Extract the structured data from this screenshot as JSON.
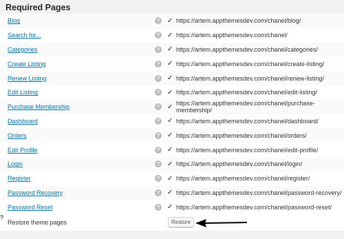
{
  "section": {
    "title": "Required Pages"
  },
  "pages": [
    {
      "label": "Blog",
      "url": "https://artem.appthemesdev.com/chanel/blog/"
    },
    {
      "label": "Search for...",
      "url": "https://artem.appthemesdev.com/chanel/"
    },
    {
      "label": "Categories",
      "url": "https://artem.appthemesdev.com/chanel/categories/"
    },
    {
      "label": "Create Listing",
      "url": "https://artem.appthemesdev.com/chanel/create-listing/"
    },
    {
      "label": "Renew Listing",
      "url": "https://artem.appthemesdev.com/chanel/renew-listing/"
    },
    {
      "label": "Edit Listing",
      "url": "https://artem.appthemesdev.com/chanel/edit-listing/"
    },
    {
      "label": "Purchase Membership",
      "url": "https://artem.appthemesdev.com/chanel/purchase-membership/"
    },
    {
      "label": "Dashboard",
      "url": "https://artem.appthemesdev.com/chanel/dashboard/"
    },
    {
      "label": "Orders",
      "url": "https://artem.appthemesdev.com/chanel/orders/"
    },
    {
      "label": "Edit Profile",
      "url": "https://artem.appthemesdev.com/chanel/edit-profile/"
    },
    {
      "label": "Login",
      "url": "https://artem.appthemesdev.com/chanel/login/"
    },
    {
      "label": "Register",
      "url": "https://artem.appthemesdev.com/chanel/register/"
    },
    {
      "label": "Password Recovery",
      "url": "https://artem.appthemesdev.com/chanel/password-recovery/"
    },
    {
      "label": "Password Reset",
      "url": "https://artem.appthemesdev.com/chanel/password-reset/"
    }
  ],
  "help_glyph": "?",
  "check_glyph": "✓",
  "restore": {
    "label": "Restore theme pages",
    "button_label": "Restore"
  },
  "icons": {
    "help": "help-icon",
    "check": "check-icon",
    "annotation": "arrow-annotation"
  }
}
